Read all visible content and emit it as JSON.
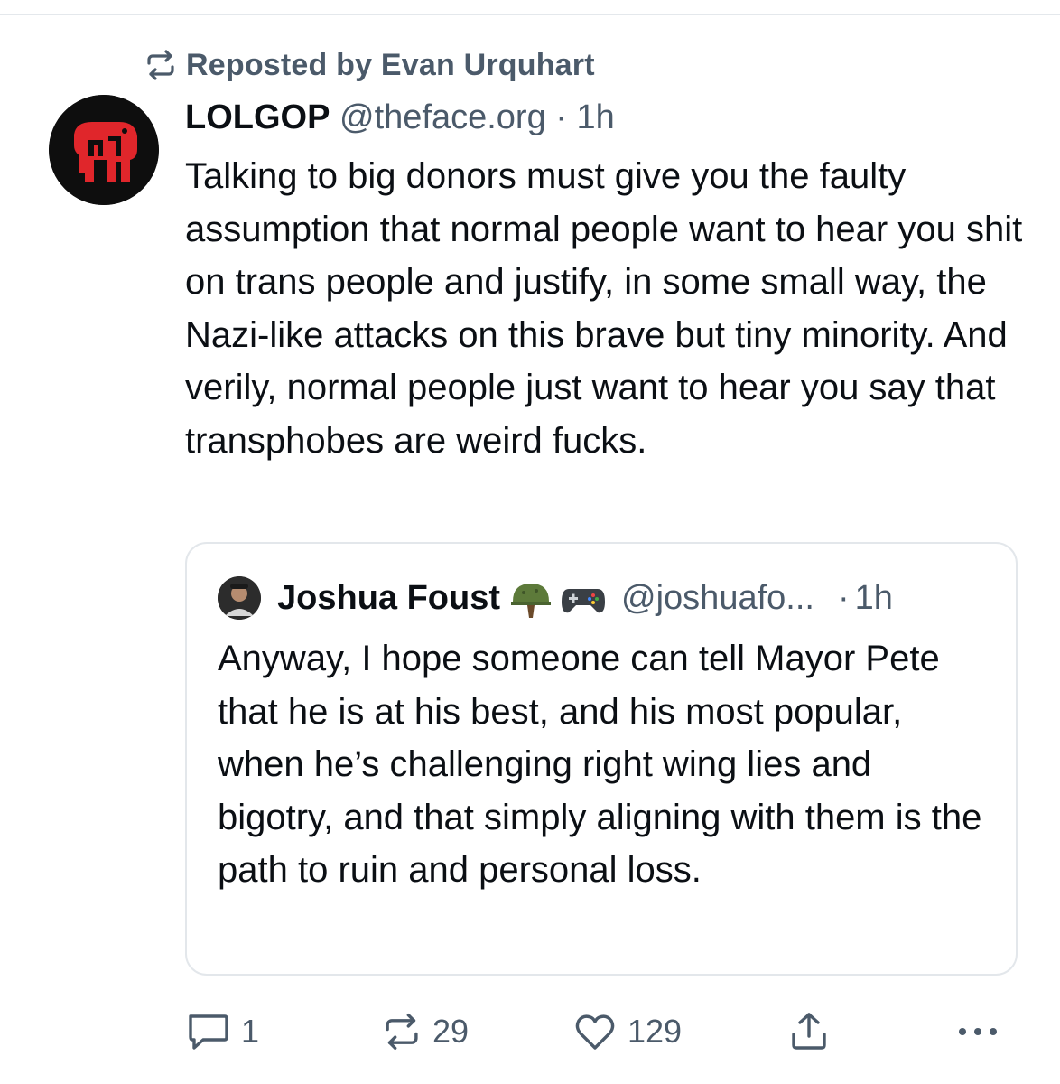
{
  "repost": {
    "label": "Reposted by Evan Urquhart",
    "icon": "repost-icon"
  },
  "post": {
    "author_name": "LOLGOP",
    "author_handle": "@theface.org",
    "separator": "·",
    "time": "1h",
    "avatar_icon": "elephant-logo",
    "text": "Talking to big donors must give you the faulty assumption that normal people want to hear you shit on trans people and justify, in some small way, the Nazi-like attacks on this brave but tiny minority. And verily, normal people just want to hear you say that transphobes are weird fucks."
  },
  "quote": {
    "author_name": "Joshua Foust",
    "emojis": [
      "military-helmet-emoji",
      "game-controller-emoji"
    ],
    "author_handle": "@joshuafo...",
    "separator": "·",
    "time": "1h",
    "text": "Anyway, I hope someone can tell Mayor Pete that he is at his best, and his most popular, when he’s challenging right wing lies and bigotry, and that simply aligning with them is the path to ruin and personal loss."
  },
  "actions": {
    "reply_count": "1",
    "repost_count": "29",
    "like_count": "129",
    "icons": [
      "reply-icon",
      "repost-icon",
      "heart-icon",
      "share-icon",
      "more-icon"
    ]
  },
  "colors": {
    "text": "#0b0f14",
    "muted": "#4b5a6a",
    "border": "#e3e7eb",
    "logo_red": "#e0262b"
  }
}
